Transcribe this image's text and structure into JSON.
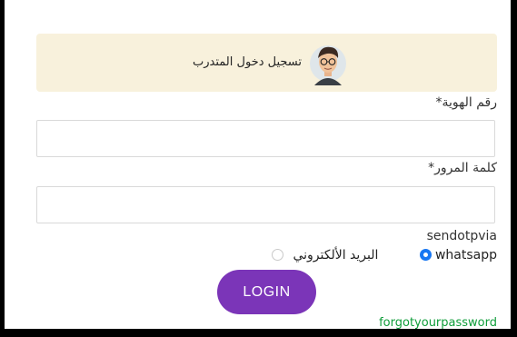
{
  "banner": {
    "title": "تسجيل دخول المتدرب",
    "avatar_icon": "trainee-avatar-icon"
  },
  "form": {
    "id_label": "رقم الهوية*",
    "id_value": "",
    "password_label": "كلمة المرور*",
    "password_value": "",
    "send_label": "sendotpvia",
    "options": [
      {
        "label": "whatsapp",
        "checked": true
      },
      {
        "label": "البريد الألكتروني",
        "checked": false
      }
    ],
    "login_label": "LOGIN",
    "forgot_label": "forgotyourpassword"
  },
  "colors": {
    "accent": "#7b35b8",
    "radio": "#1877f2",
    "link": "#0f9d3a",
    "banner_bg": "#f8f1dc"
  }
}
